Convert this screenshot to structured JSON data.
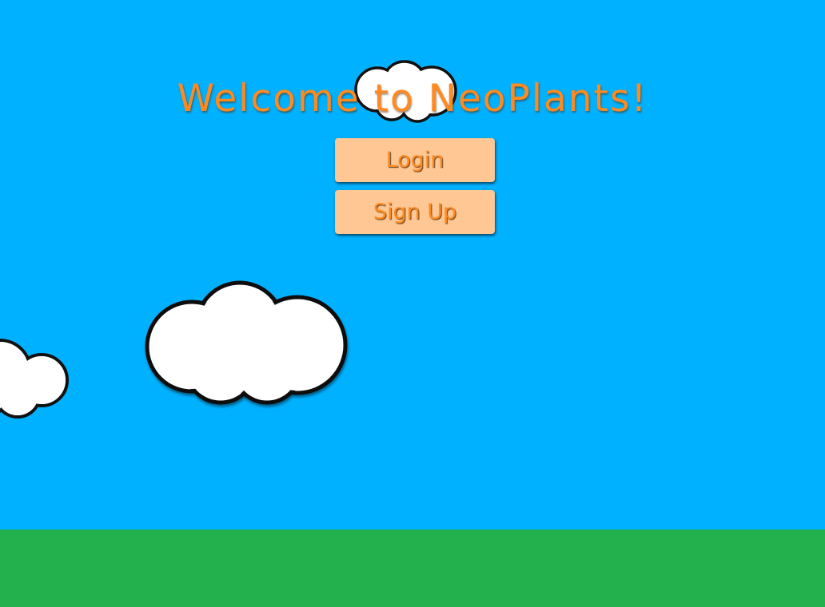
{
  "page": {
    "title": "Welcome to NeoPlants!"
  },
  "auth": {
    "login_label": "Login",
    "signup_label": "Sign Up"
  },
  "colors": {
    "sky": "#00b1ff",
    "ground": "#22b14c",
    "title_text": "#ff8a1f",
    "button_bg": "#ffc793",
    "cloud_fill": "#ffffff",
    "cloud_stroke": "#111111"
  }
}
